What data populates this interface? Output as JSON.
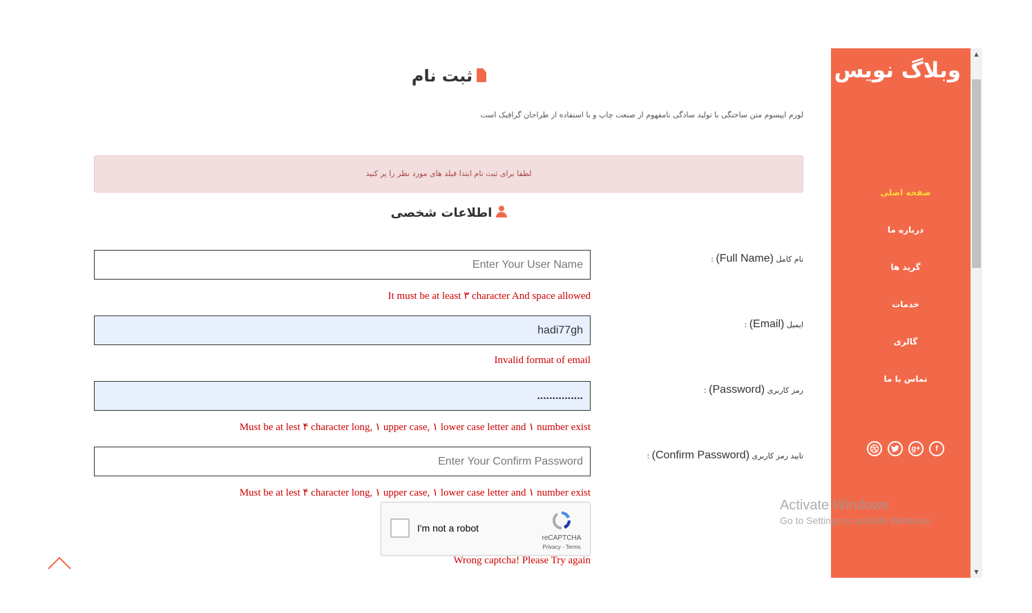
{
  "sidebar": {
    "logo": "وبلاگ نویس",
    "nav": [
      {
        "label": "صفحه اصلی",
        "active": true
      },
      {
        "label": "درباره ما",
        "active": false
      },
      {
        "label": "گرید ها",
        "active": false
      },
      {
        "label": "خدمات",
        "active": false
      },
      {
        "label": "گالری",
        "active": false
      },
      {
        "label": "تماس با ما",
        "active": false
      }
    ],
    "social_icons": [
      "facebook-icon",
      "google-plus-icon",
      "twitter-icon",
      "dribbble-icon"
    ]
  },
  "main": {
    "title": "ثبت نام",
    "intro": "لورم ایپسوم متن ساختگی با تولید سادگی نامفهوم از صنعت چاپ و با استفاده از طراحان گرافیک است",
    "alert": "لطفا برای ثبت نام ابتدا فیلد های مورد نظر را پر کنید",
    "section_title": "اطلاعات شخصی",
    "fields": [
      {
        "label_fa": "نام کامل",
        "label_en": "(Full Name)",
        "label_sep": ":",
        "value": "",
        "placeholder": "Enter Your User Name",
        "error": "It must be at least ۳ character And space allowed"
      },
      {
        "label_fa": "ایمیل",
        "label_en": "(Email)",
        "label_sep": ":",
        "value": "hadi77gh",
        "placeholder": "",
        "error": "Invalid format of email"
      },
      {
        "label_fa": "رمز کاربری",
        "label_en": "(Password)",
        "label_sep": ":",
        "value": "...............",
        "placeholder": "",
        "error": "Must be at lest ۴ character long, ۱ upper case, ۱ lower case letter and ۱ number exist"
      },
      {
        "label_fa": "تایید رمز کاربری",
        "label_en": "(Confirm Password)",
        "label_sep": ":",
        "value": "",
        "placeholder": "Enter Your Confirm Password",
        "error": "Must be at lest ۴ character long, ۱ upper case, ۱ lower case letter and ۱ number exist"
      }
    ],
    "captcha": {
      "label": "I'm not a robot",
      "brand": "reCAPTCHA",
      "links": "Privacy - Terms",
      "error": "Wrong captcha! Please Try again"
    }
  },
  "watermark": {
    "line1": "Activate Windows",
    "line2": "Go to Settings to activate Windows."
  },
  "colors": {
    "accent": "#f2694a",
    "active_nav": "#ffd83a",
    "error": "#cc0000",
    "alert_bg": "#f2dede",
    "autofill_bg": "#e8f0fe"
  }
}
